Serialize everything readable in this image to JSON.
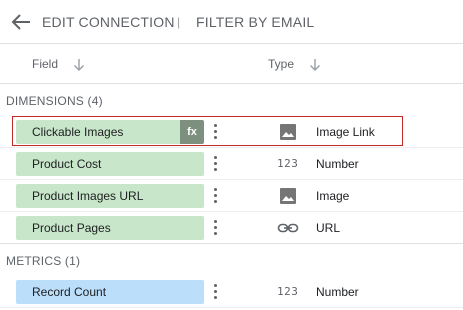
{
  "header": {
    "back_icon": "arrow-left-icon",
    "title": "EDIT CONNECTION",
    "separator": "|",
    "filter": "FILTER BY EMAIL"
  },
  "columns": {
    "field": "Field",
    "type": "Type",
    "sort_icon": "arrow-down-icon"
  },
  "dimensions": {
    "label": "DIMENSIONS (4)",
    "rows": [
      {
        "name": "Clickable Images",
        "type": "Image Link",
        "type_icon": "image-icon",
        "badge": "fx",
        "selected": true
      },
      {
        "name": "Product Cost",
        "type": "Number",
        "type_icon": "number-icon",
        "type_glyph": "123"
      },
      {
        "name": "Product Images URL",
        "type": "Image",
        "type_icon": "image-icon"
      },
      {
        "name": "Product Pages",
        "type": "URL",
        "type_icon": "link-icon"
      }
    ]
  },
  "metrics": {
    "label": "METRICS (1)",
    "rows": [
      {
        "name": "Record Count",
        "type": "Number",
        "type_icon": "number-icon",
        "type_glyph": "123"
      }
    ]
  },
  "colors": {
    "dimension_chip": "#c8e6c9",
    "metric_chip": "#bbdefb",
    "fx_badge": "#7d8f7e",
    "selection_outline": "#c62828"
  }
}
